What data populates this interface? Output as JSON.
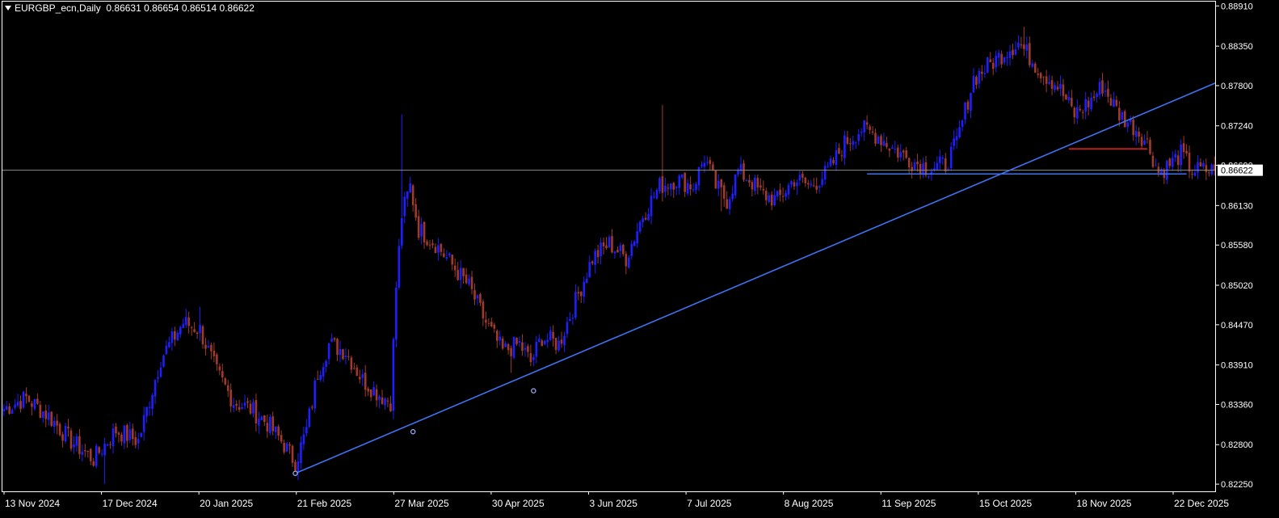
{
  "header": {
    "symbol_timeframe": "EURGBP_ecn,Daily",
    "ohlc": "0.86631 0.86654 0.86514 0.86622"
  },
  "colors": {
    "background": "#000000",
    "axis": "#ffffff",
    "bull_candle": "#1e1eff",
    "bear_candle": "#a03a2a",
    "trend_line": "#3f72f0",
    "support_line": "#3f72f0",
    "resistance_line": "#e01a1a",
    "price_line": "#8c8c8c",
    "price_tag_bg": "#ffffff"
  },
  "chart_data": {
    "type": "candlestick",
    "y_ticks": [
      "0.88910",
      "0.88350",
      "0.87800",
      "0.87240",
      "0.86690",
      "0.86130",
      "0.85580",
      "0.85020",
      "0.84470",
      "0.83910",
      "0.83360",
      "0.82800",
      "0.82250"
    ],
    "ylim": [
      0.8215,
      0.8897
    ],
    "x_labels": [
      "13 Nov 2024",
      "17 Dec 2024",
      "20 Jan 2025",
      "21 Feb 2025",
      "27 Mar 2025",
      "30 Apr 2025",
      "3 Jun 2025",
      "7 Jul 2025",
      "8 Aug 2025",
      "11 Sep 2025",
      "15 Oct 2025",
      "18 Nov 2025",
      "22 Dec 2025"
    ],
    "current_price": "0.86622",
    "last_close": 0.86622,
    "close_path": [
      [
        0,
        0.833
      ],
      [
        8,
        0.8345
      ],
      [
        16,
        0.832
      ],
      [
        24,
        0.8285
      ],
      [
        32,
        0.826
      ],
      [
        40,
        0.83
      ],
      [
        48,
        0.8285
      ],
      [
        56,
        0.84
      ],
      [
        64,
        0.845
      ],
      [
        70,
        0.844
      ],
      [
        76,
        0.838
      ],
      [
        82,
        0.834
      ],
      [
        88,
        0.833
      ],
      [
        94,
        0.831
      ],
      [
        100,
        0.828
      ],
      [
        104,
        0.8255
      ],
      [
        108,
        0.83
      ],
      [
        112,
        0.838
      ],
      [
        116,
        0.842
      ],
      [
        122,
        0.841
      ],
      [
        128,
        0.837
      ],
      [
        134,
        0.835
      ],
      [
        138,
        0.834
      ],
      [
        140,
        0.85
      ],
      [
        142,
        0.86
      ],
      [
        145,
        0.864
      ],
      [
        148,
        0.858
      ],
      [
        154,
        0.856
      ],
      [
        160,
        0.853
      ],
      [
        166,
        0.85
      ],
      [
        172,
        0.845
      ],
      [
        178,
        0.841
      ],
      [
        184,
        0.842
      ],
      [
        188,
        0.8395
      ],
      [
        192,
        0.843
      ],
      [
        198,
        0.842
      ],
      [
        204,
        0.848
      ],
      [
        210,
        0.854
      ],
      [
        216,
        0.856
      ],
      [
        222,
        0.854
      ],
      [
        228,
        0.86
      ],
      [
        234,
        0.864
      ],
      [
        240,
        0.865
      ],
      [
        246,
        0.864
      ],
      [
        250,
        0.868
      ],
      [
        254,
        0.864
      ],
      [
        258,
        0.862
      ],
      [
        262,
        0.866
      ],
      [
        266,
        0.865
      ],
      [
        270,
        0.863
      ],
      [
        276,
        0.862
      ],
      [
        282,
        0.865
      ],
      [
        288,
        0.864
      ],
      [
        294,
        0.866
      ],
      [
        300,
        0.87
      ],
      [
        306,
        0.872
      ],
      [
        312,
        0.871
      ],
      [
        318,
        0.869
      ],
      [
        324,
        0.8675
      ],
      [
        330,
        0.8665
      ],
      [
        336,
        0.867
      ],
      [
        340,
        0.87
      ],
      [
        346,
        0.879
      ],
      [
        352,
        0.881
      ],
      [
        358,
        0.883
      ],
      [
        362,
        0.884
      ],
      [
        366,
        0.882
      ],
      [
        370,
        0.88
      ],
      [
        376,
        0.878
      ],
      [
        382,
        0.874
      ],
      [
        388,
        0.876
      ],
      [
        392,
        0.878
      ],
      [
        398,
        0.874
      ],
      [
        404,
        0.872
      ],
      [
        408,
        0.87
      ],
      [
        412,
        0.866
      ],
      [
        416,
        0.867
      ],
      [
        420,
        0.8685
      ],
      [
        424,
        0.8662
      ]
    ],
    "extremes": [
      [
        36,
        0.8225,
        "low"
      ],
      [
        70,
        0.8472,
        "high"
      ],
      [
        104,
        0.824,
        "low"
      ],
      [
        142,
        0.874,
        "high"
      ],
      [
        181,
        0.838,
        "low"
      ],
      [
        235,
        0.8753,
        "high"
      ],
      [
        256,
        0.8605,
        "low"
      ],
      [
        364,
        0.8862,
        "high"
      ],
      [
        413,
        0.8655,
        "low"
      ]
    ],
    "overlays": {
      "trend_line": {
        "from": [
          104,
          0.824
        ],
        "to": [
          433,
          0.8784
        ],
        "anchors": [
          [
            104,
            0.824
          ],
          [
            146,
            0.8298
          ],
          [
            189,
            0.8355
          ]
        ]
      },
      "support_line": {
        "from": [
          308,
          0.8657
        ],
        "to": [
          422,
          0.8657
        ]
      },
      "resistance_line": {
        "from": [
          380,
          0.8692
        ],
        "to": [
          408,
          0.8692
        ]
      }
    },
    "grid": false
  }
}
